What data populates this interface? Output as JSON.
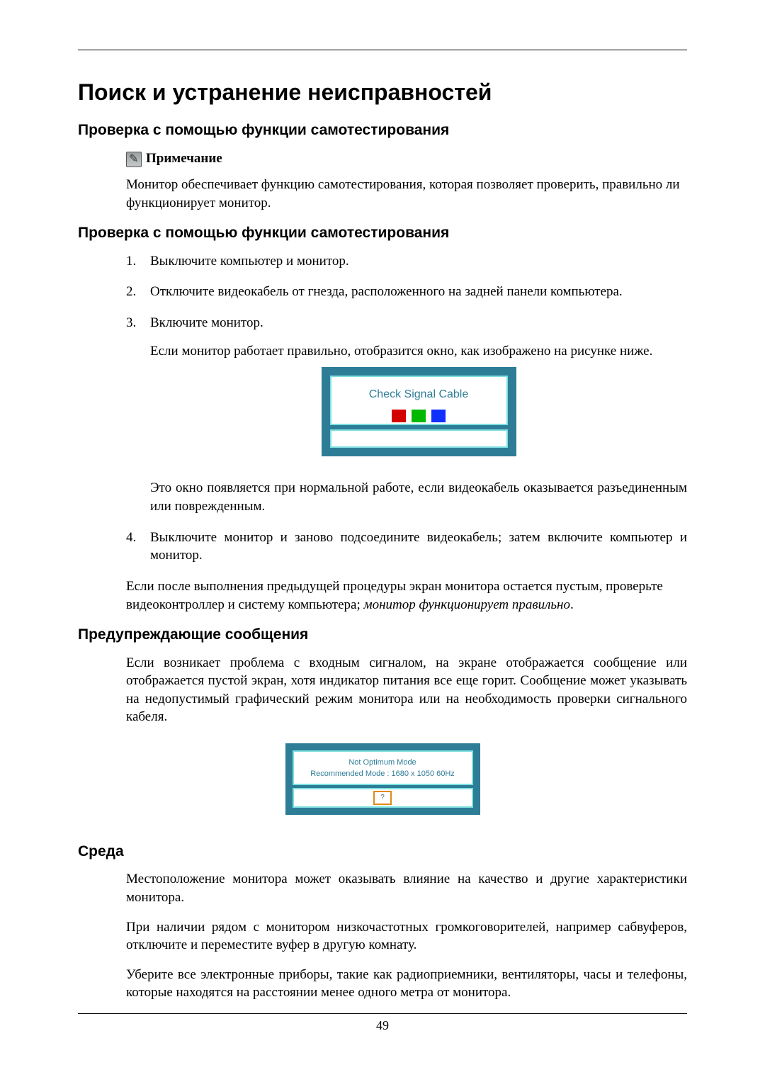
{
  "page": {
    "title": "Поиск и устранение неисправностей",
    "number": "49"
  },
  "section1": {
    "heading": "Проверка с помощью функции самотестирования",
    "note_label": "Примечание",
    "note_body": "Монитор обеспечивает функцию самотестирования, которая позволяет проверить, правильно ли функционирует монитор."
  },
  "section2": {
    "heading": "Проверка с помощью функции самотестирования",
    "steps": {
      "s1": "Выключите компьютер и монитор.",
      "s2": "Отключите видеокабель от гнезда, расположенного на задней панели компьютера.",
      "s3a": "Включите монитор.",
      "s3b": "Если монитор работает правильно, отобразится окно, как изображено на рисунке ниже.",
      "s3c": "Это окно появляется при нормальной работе, если видеокабель оказывается разъединенным или поврежденным.",
      "s4": "Выключите монитор и заново подсоедините видеокабель; затем включите компьютер и монитор."
    },
    "after_steps_a": "Если после выполнения предыдущей процедуры экран монитора остается пустым, проверьте видеоконтроллер и систему компьютера; ",
    "after_steps_italic": "монитор функционирует правильно",
    "after_steps_end": "."
  },
  "osd1": {
    "title": "Check Signal Cable"
  },
  "section3": {
    "heading": "Предупреждающие сообщения",
    "body": "Если возникает проблема с входным сигналом, на экране отображается сообщение или отображается пустой экран, хотя индикатор питания все еще горит. Сообщение может указывать на недопустимый графический режим монитора или на необходимость проверки сигнального кабеля."
  },
  "osd2": {
    "line1": "Not Optimum Mode",
    "line2": "Recommended Mode : 1680 x 1050 60Hz",
    "btn": "?"
  },
  "section4": {
    "heading": "Среда",
    "p1": "Местоположение монитора может оказывать влияние на качество и другие характеристики монитора.",
    "p2": "При наличии рядом с монитором низкочастотных громкоговорителей, например сабвуферов, отключите и переместите вуфер в другую комнату.",
    "p3": "Уберите все электронные приборы, такие как радиоприемники, вентиляторы, часы и телефоны, которые находятся на расстоянии менее одного метра от монитора."
  }
}
